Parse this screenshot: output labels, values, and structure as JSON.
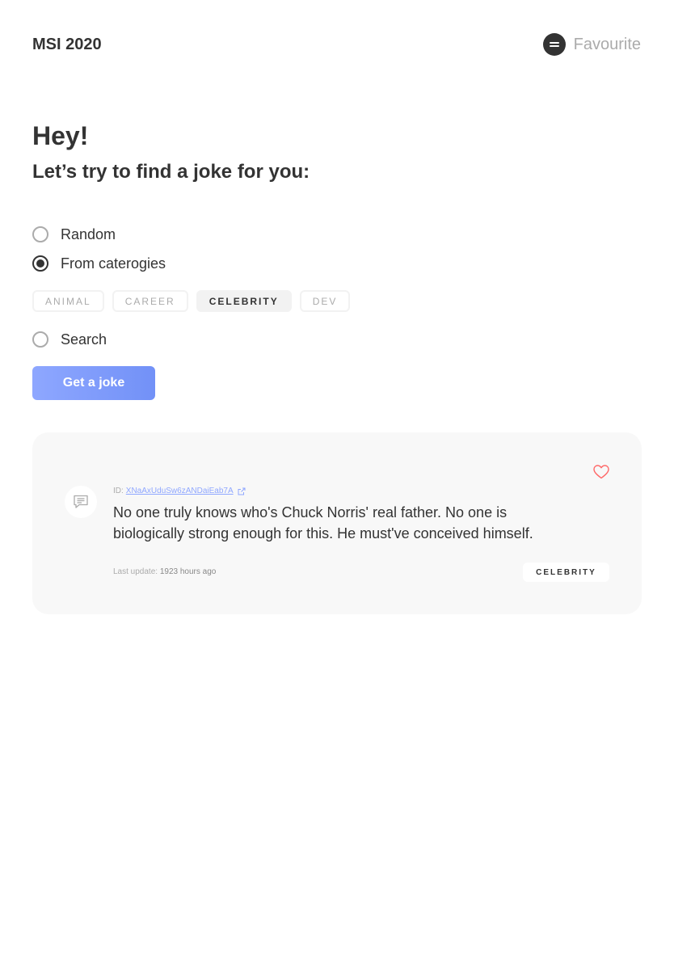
{
  "header": {
    "logo": "MSI 2020",
    "favourite_label": "Favourite",
    "favourite_icon": "menu-icon"
  },
  "intro": {
    "greeting": "Hey!",
    "subtitle": "Let’s try to find a joke for you:"
  },
  "options": {
    "random_label": "Random",
    "categories_label": "From caterogies",
    "search_label": "Search",
    "selected": "categories"
  },
  "categories": [
    {
      "label": "ANIMAL",
      "active": false
    },
    {
      "label": "CAREER",
      "active": false
    },
    {
      "label": "CELEBRITY",
      "active": true
    },
    {
      "label": "DEV",
      "active": false
    }
  ],
  "get_button": {
    "label": "Get a joke",
    "gradient": [
      "#8ea7ff",
      "#7291f7"
    ]
  },
  "joke": {
    "id_label": "ID:",
    "id_value": "XNaAxUduSw6zANDaiEab7A",
    "text": "No one truly knows who's Chuck Norris' real father. No one is biologically strong enough for this. He must've conceived himself.",
    "last_update_label": "Last update:",
    "last_update_value": "1923 hours ago",
    "category": "CELEBRITY",
    "favourite": false,
    "icons": [
      "message-icon",
      "heart-icon",
      "external-link-icon"
    ]
  },
  "colors": {
    "text": "#333333",
    "muted": "#ababab",
    "accent": "#8fa7ff",
    "heart": "#ff6767",
    "card_bg": "#f8f8f8"
  }
}
